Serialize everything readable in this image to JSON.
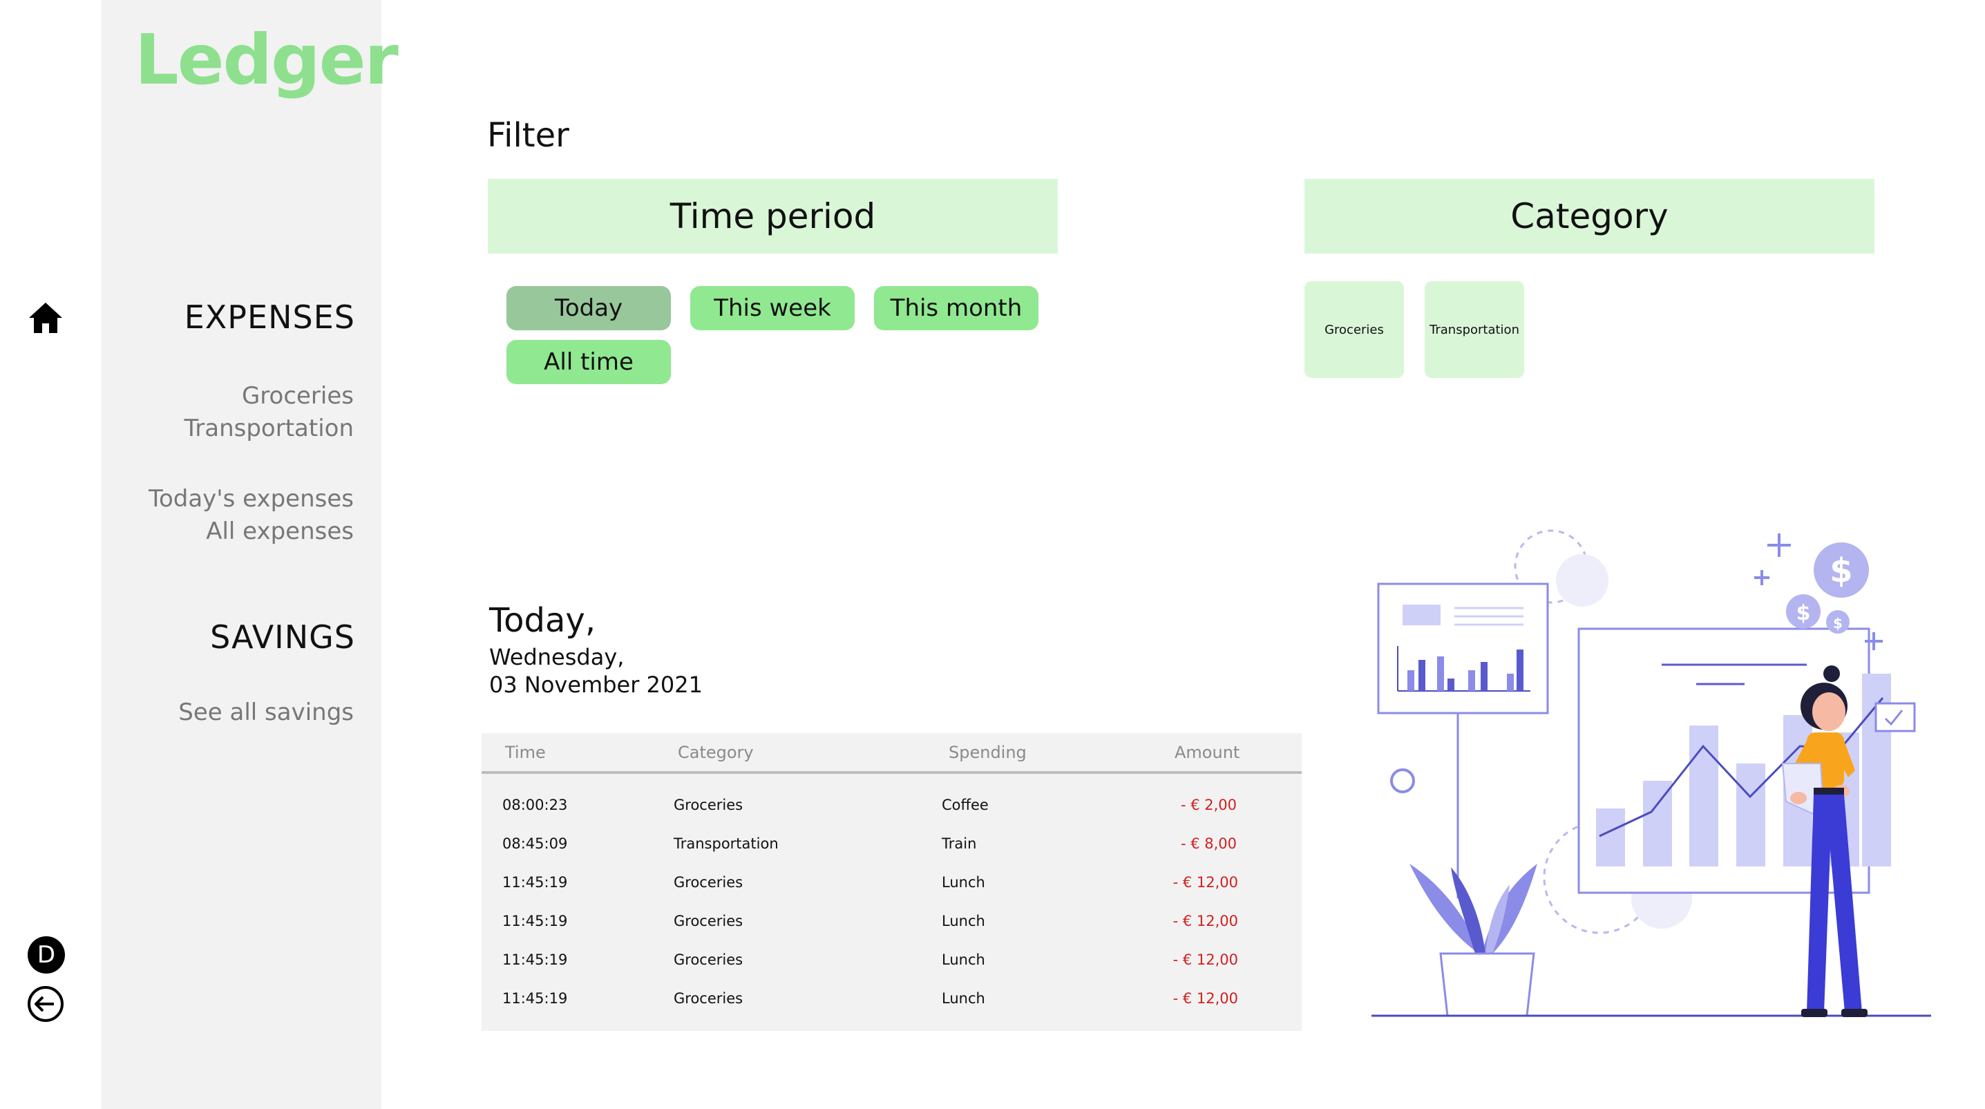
{
  "app": {
    "logo": "Ledger"
  },
  "rail": {
    "avatar_initial": "D",
    "home_icon": "home-icon",
    "logout_icon": "logout-icon"
  },
  "sidebar": {
    "expenses_heading": "EXPENSES",
    "expense_links": [
      "Groceries",
      "Transportation"
    ],
    "view_links": [
      "Today's expenses",
      "All expenses"
    ],
    "savings_heading": "SAVINGS",
    "savings_links": [
      "See all savings"
    ]
  },
  "filter": {
    "title": "Filter",
    "time_period": {
      "heading": "Time period",
      "options": [
        "Today",
        "This week",
        "This month",
        "All time"
      ],
      "selected": "Today"
    },
    "category": {
      "heading": "Category",
      "options": [
        "Groceries",
        "Transportation"
      ]
    }
  },
  "day": {
    "label": "Today,",
    "weekday": "Wednesday,",
    "date": "03 November 2021"
  },
  "table": {
    "columns": [
      "Time",
      "Category",
      "Spending",
      "Amount"
    ],
    "rows": [
      {
        "time": "08:00:23",
        "category": "Groceries",
        "spending": "Coffee",
        "amount": "- € 2,00"
      },
      {
        "time": "08:45:09",
        "category": "Transportation",
        "spending": "Train",
        "amount": "- € 8,00"
      },
      {
        "time": "11:45:19",
        "category": "Groceries",
        "spending": "Lunch",
        "amount": "- € 12,00"
      },
      {
        "time": "11:45:19",
        "category": "Groceries",
        "spending": "Lunch",
        "amount": "- € 12,00"
      },
      {
        "time": "11:45:19",
        "category": "Groceries",
        "spending": "Lunch",
        "amount": "- € 12,00"
      },
      {
        "time": "11:45:19",
        "category": "Groceries",
        "spending": "Lunch",
        "amount": "- € 12,00"
      }
    ]
  },
  "colors": {
    "brand_green": "#8ee08e",
    "chip_green": "#90e890",
    "chip_selected": "#97c79b",
    "panel_green": "#d9f7d7",
    "amount_red": "#d21f1f",
    "illustration_purple": "#8b8be8"
  }
}
